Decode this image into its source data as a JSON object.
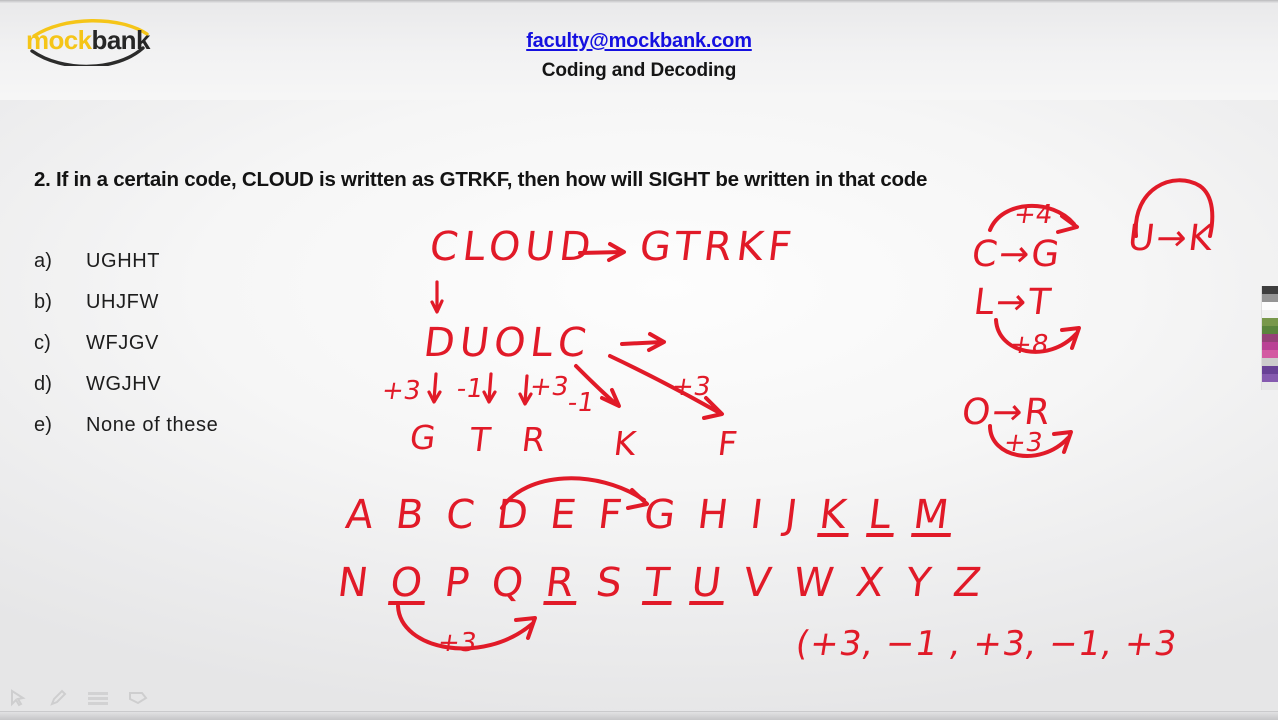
{
  "brand": {
    "logo_mock": "mock",
    "logo_bank": "bank",
    "logo_accent_color": "#f5c518",
    "logo_text_color": "#262626"
  },
  "header": {
    "email": "faculty@mockbank.com",
    "email_color": "#1510e0",
    "subject": "Coding and Decoding"
  },
  "question": {
    "text": "2. If in a certain code, CLOUD is written as GTRKF, then how will SIGHT be written in that code"
  },
  "options": [
    {
      "key": "a)",
      "value": "UGHHT"
    },
    {
      "key": "b)",
      "value": "UHJFW"
    },
    {
      "key": "c)",
      "value": "WFJGV"
    },
    {
      "key": "d)",
      "value": "WGJHV"
    },
    {
      "key": "e)",
      "value": "None of these"
    }
  ],
  "annotations": {
    "ink_color": "#e11a28",
    "line1_word": "CLOUD",
    "line1_code": "GTRKF",
    "reversed_word": "DUOLC",
    "result_letters": [
      "G",
      "T",
      "R",
      "K",
      "F"
    ],
    "shift_labels": [
      "+3",
      "-1",
      "+3",
      "-1",
      "+3"
    ],
    "alphabet_row1": [
      "A",
      "B",
      "C",
      "D",
      "E",
      "F",
      "G",
      "H",
      "I",
      "J",
      "K",
      "L",
      "M"
    ],
    "alphabet_row2": [
      "N",
      "O",
      "P",
      "Q",
      "R",
      "S",
      "T",
      "U",
      "V",
      "W",
      "X",
      "Y",
      "Z"
    ],
    "arc_label_alphabet": "+3",
    "pattern_summary": "(+3, −1 , +3, −1, +3",
    "side_notes": [
      {
        "mapping": "C→G",
        "shift": "+4"
      },
      {
        "mapping": "L→T",
        "shift": "+8"
      },
      {
        "mapping": "U→K",
        "shift": ""
      },
      {
        "mapping": "O→R",
        "shift": "+3"
      }
    ],
    "side_c_to_g": "C→G",
    "side_c_to_g_shift": "+4",
    "side_l_to_t": "L→T",
    "side_l_to_t_shift": "+8",
    "side_u_to_k": "U→K",
    "side_o_to_r": "O→R",
    "side_o_to_r_shift": "+3"
  },
  "palette": {
    "swatches": [
      "#2b2b2b",
      "#8c8c8c",
      "#ffffff",
      "#f2f2f2",
      "#6b8f3a",
      "#4a7a2a",
      "#8c2f6b",
      "#b52f8c",
      "#d04a9a",
      "#c8c8c8",
      "#5a2f8c",
      "#7a4aa8",
      "#e8e8e8"
    ]
  },
  "toolbar": {
    "tools": [
      "cursor-tool",
      "pen-tool",
      "lines-tool",
      "eraser-tool"
    ]
  }
}
